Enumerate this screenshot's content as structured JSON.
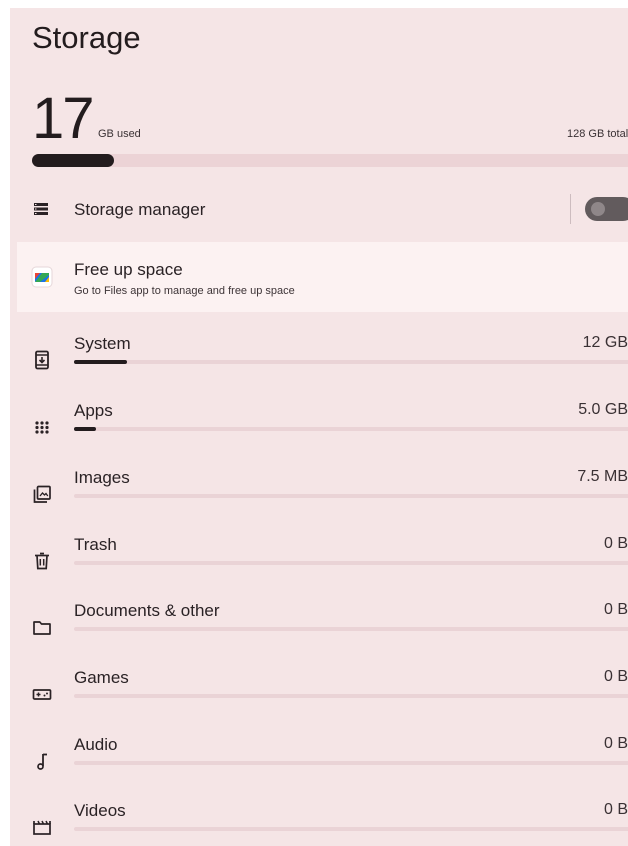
{
  "title": "Storage",
  "usage": {
    "used_value": "17",
    "used_unit": "GB used",
    "total": "128 GB total",
    "used_fraction": 0.133
  },
  "storage_manager": {
    "label": "Storage manager",
    "enabled": false
  },
  "free_up": {
    "title": "Free up space",
    "subtitle": "Go to Files app to manage and free up space"
  },
  "categories": [
    {
      "label": "System",
      "size": "12 GB",
      "fraction": 0.094,
      "icon": "system-update-icon"
    },
    {
      "label": "Apps",
      "size": "5.0 GB",
      "fraction": 0.04,
      "icon": "apps-grid-icon"
    },
    {
      "label": "Images",
      "size": "7.5 MB",
      "fraction": 0.0,
      "icon": "images-icon"
    },
    {
      "label": "Trash",
      "size": "0 B",
      "fraction": 0.0,
      "icon": "trash-icon"
    },
    {
      "label": "Documents & other",
      "size": "0 B",
      "fraction": 0.0,
      "icon": "folder-icon"
    },
    {
      "label": "Games",
      "size": "0 B",
      "fraction": 0.0,
      "icon": "gamepad-icon"
    },
    {
      "label": "Audio",
      "size": "0 B",
      "fraction": 0.0,
      "icon": "music-note-icon"
    },
    {
      "label": "Videos",
      "size": "0 B",
      "fraction": 0.0,
      "icon": "video-clapper-icon"
    }
  ]
}
